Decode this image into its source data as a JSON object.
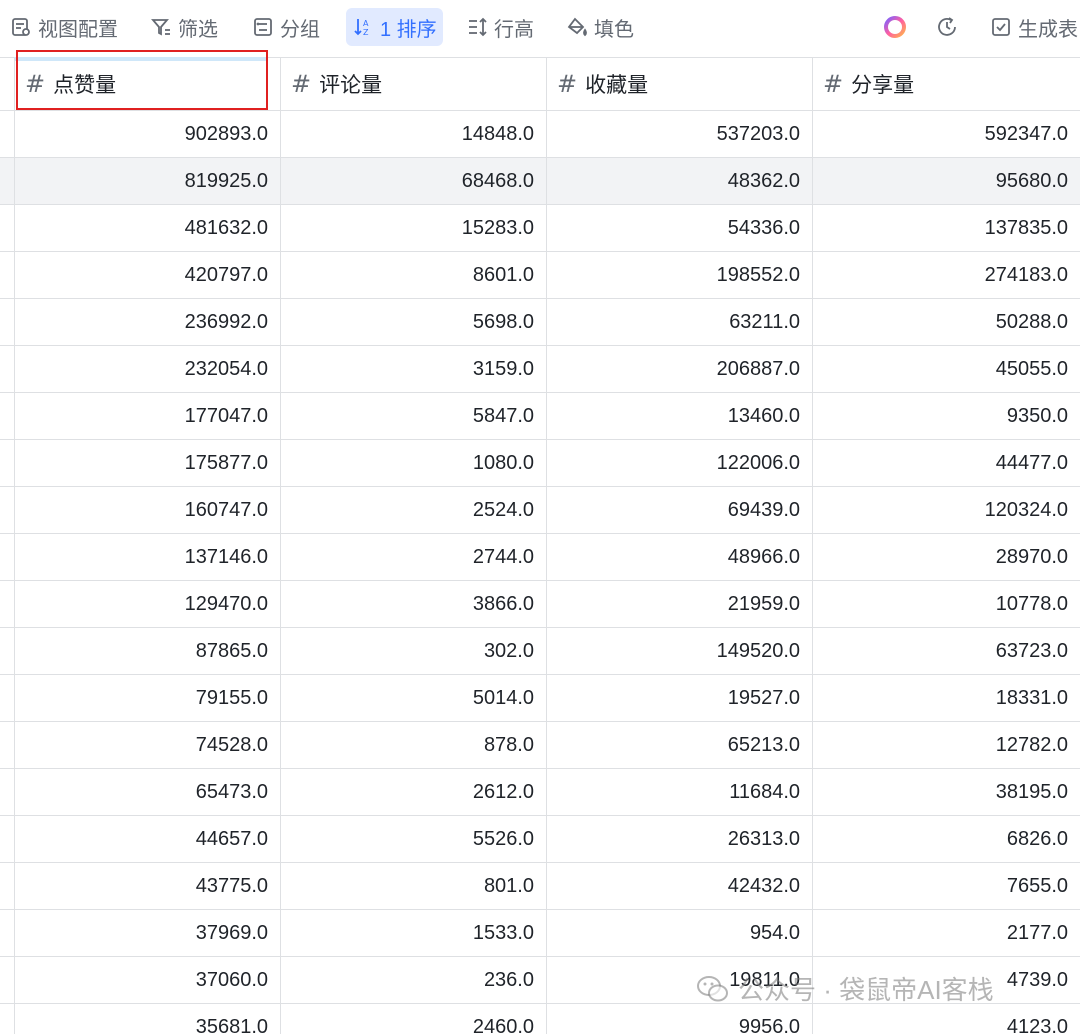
{
  "toolbar": {
    "items": [
      {
        "label": "视图配置",
        "icon": "view-config-icon"
      },
      {
        "label": "筛选",
        "icon": "filter-icon"
      },
      {
        "label": "分组",
        "icon": "group-icon"
      },
      {
        "label": "1 排序",
        "icon": "sort-icon"
      },
      {
        "label": "行高",
        "icon": "row-height-icon"
      },
      {
        "label": "填色",
        "icon": "fill-color-icon"
      },
      {
        "label": "生成表",
        "icon": "generate-table-icon"
      }
    ],
    "active_color": "#3370ff"
  },
  "table": {
    "columns": [
      {
        "type_symbol": "#",
        "label": "点赞量"
      },
      {
        "type_symbol": "#",
        "label": "评论量"
      },
      {
        "type_symbol": "#",
        "label": "收藏量"
      },
      {
        "type_symbol": "#",
        "label": "分享量"
      }
    ],
    "rows": [
      [
        "902893.0",
        "14848.0",
        "537203.0",
        "592347.0"
      ],
      [
        "819925.0",
        "68468.0",
        "48362.0",
        "95680.0"
      ],
      [
        "481632.0",
        "15283.0",
        "54336.0",
        "137835.0"
      ],
      [
        "420797.0",
        "8601.0",
        "198552.0",
        "274183.0"
      ],
      [
        "236992.0",
        "5698.0",
        "63211.0",
        "50288.0"
      ],
      [
        "232054.0",
        "3159.0",
        "206887.0",
        "45055.0"
      ],
      [
        "177047.0",
        "5847.0",
        "13460.0",
        "9350.0"
      ],
      [
        "175877.0",
        "1080.0",
        "122006.0",
        "44477.0"
      ],
      [
        "160747.0",
        "2524.0",
        "69439.0",
        "120324.0"
      ],
      [
        "137146.0",
        "2744.0",
        "48966.0",
        "28970.0"
      ],
      [
        "129470.0",
        "3866.0",
        "21959.0",
        "10778.0"
      ],
      [
        "87865.0",
        "302.0",
        "149520.0",
        "63723.0"
      ],
      [
        "79155.0",
        "5014.0",
        "19527.0",
        "18331.0"
      ],
      [
        "74528.0",
        "878.0",
        "65213.0",
        "12782.0"
      ],
      [
        "65473.0",
        "2612.0",
        "11684.0",
        "38195.0"
      ],
      [
        "44657.0",
        "5526.0",
        "26313.0",
        "6826.0"
      ],
      [
        "43775.0",
        "801.0",
        "42432.0",
        "7655.0"
      ],
      [
        "37969.0",
        "1533.0",
        "954.0",
        "2177.0"
      ],
      [
        "37060.0",
        "236.0",
        "19811.0",
        "4739.0"
      ],
      [
        "35681.0",
        "2460.0",
        "9956.0",
        "4123.0"
      ]
    ],
    "selected_column": "点赞量",
    "hovered_row": 2
  },
  "watermark": {
    "text": "公众号 · 袋鼠帝AI客栈"
  }
}
